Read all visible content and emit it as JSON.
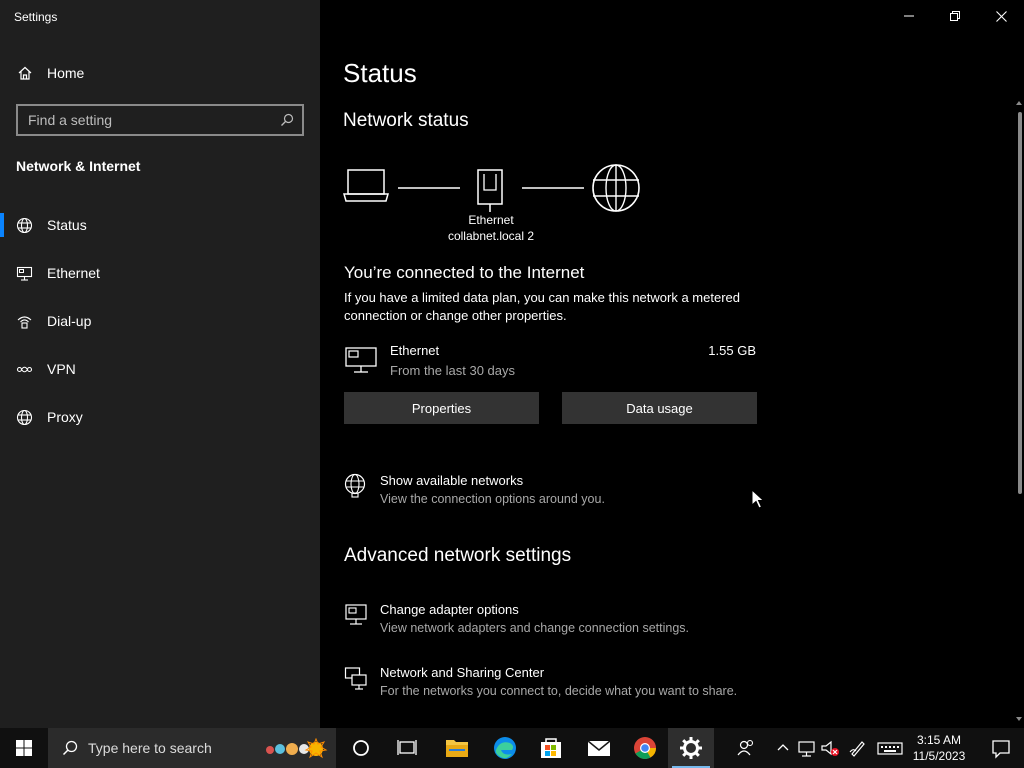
{
  "window": {
    "app_title": "Settings"
  },
  "sidebar": {
    "home_label": "Home",
    "search_placeholder": "Find a setting",
    "section_title": "Network & Internet",
    "items": [
      {
        "label": "Status",
        "icon": "globe-icon",
        "active": true
      },
      {
        "label": "Ethernet",
        "icon": "ethernet-icon",
        "active": false
      },
      {
        "label": "Dial-up",
        "icon": "dialup-icon",
        "active": false
      },
      {
        "label": "VPN",
        "icon": "vpn-icon",
        "active": false
      },
      {
        "label": "Proxy",
        "icon": "globe-icon",
        "active": false
      }
    ]
  },
  "main": {
    "page_title": "Status",
    "network_status_title": "Network status",
    "diagram": {
      "adapter_name": "Ethernet",
      "network_name": "collabnet.local 2"
    },
    "connected_heading": "You’re connected to the Internet",
    "connected_desc": "If you have a limited data plan, you can make this network a metered connection or change other properties.",
    "ethernet_name": "Ethernet",
    "ethernet_period": "From the last 30 days",
    "ethernet_usage": "1.55 GB",
    "properties_button": "Properties",
    "data_usage_button": "Data usage",
    "show_networks_title": "Show available networks",
    "show_networks_desc": "View the connection options around you.",
    "advanced_heading": "Advanced network settings",
    "adapter_options_title": "Change adapter options",
    "adapter_options_desc": "View network adapters and change connection settings.",
    "sharing_center_title": "Network and Sharing Center",
    "sharing_center_desc": "For the networks you connect to, decide what you want to share."
  },
  "taskbar": {
    "search_placeholder": "Type here to search",
    "time": "3:15 AM",
    "date": "11/5/2023"
  },
  "colors": {
    "accent": "#0a84ff",
    "sidebar_bg": "#1f1f1f",
    "main_bg": "#000000",
    "button_bg": "#333333"
  }
}
